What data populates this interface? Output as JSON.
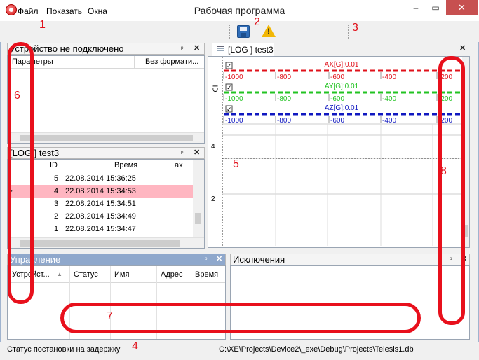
{
  "window": {
    "title": "Рабочая программа",
    "min": "–",
    "max": "▭",
    "close": "✕"
  },
  "menu": {
    "items": [
      "Файл",
      "Показать",
      "Окна"
    ]
  },
  "device_panel": {
    "title": "Устройство не подключено",
    "col_params": "Параметры",
    "col_format": "Без формати..."
  },
  "log_panel": {
    "title": "[LOG ] test3",
    "columns": [
      "ID",
      "Время",
      "ax"
    ],
    "rows": [
      {
        "id": "5",
        "time": "22.08.2014 15:36:25",
        "selected": false
      },
      {
        "id": "4",
        "time": "22.08.2014 15:34:53",
        "selected": true
      },
      {
        "id": "3",
        "time": "22.08.2014 15:34:51",
        "selected": false
      },
      {
        "id": "2",
        "time": "22.08.2014 15:34:49",
        "selected": false
      },
      {
        "id": "1",
        "time": "22.08.2014 15:34:47",
        "selected": false
      }
    ],
    "pointer": "▶"
  },
  "control_panel": {
    "title": "Управление",
    "columns": [
      "Устройст...",
      "Статус",
      "Имя",
      "Адрес",
      "Время"
    ]
  },
  "exceptions_panel": {
    "title": "Исключения"
  },
  "document_tab": {
    "label": "[LOG ] test3"
  },
  "chart_data": {
    "type": "line",
    "series": [
      {
        "name": "AX[G]:0.01",
        "color": "#e0101a",
        "checked": true,
        "ticks": [
          "-1000",
          "-800",
          "-600",
          "-400",
          "-200"
        ]
      },
      {
        "name": "AY[G]:0.01",
        "color": "#22c322",
        "checked": true,
        "ticks": [
          "-1000",
          "-800",
          "-600",
          "-400",
          "-200"
        ]
      },
      {
        "name": "AZ[G]:0.01",
        "color": "#1018c0",
        "checked": true,
        "ticks": [
          "-1000",
          "-800",
          "-600",
          "-400",
          "-200"
        ]
      }
    ],
    "y_tick_labels": [
      "4",
      "2"
    ],
    "side_label": "ID",
    "grid": true
  },
  "status": {
    "left": "Статус постановки на задержку",
    "right": "C:\\XE\\Projects\\Device2\\_exe\\Debug\\Projects\\Telesis1.db"
  },
  "annotations": [
    "1",
    "2",
    "3",
    "4",
    "5",
    "6",
    "7",
    "8"
  ],
  "pin_glyph": "ᵖ",
  "close_glyph": "✕",
  "check_glyph": "✓",
  "colors": {
    "annotation": "#e8101c",
    "selection": "#ffb6c1",
    "active_panel": "#8fa8cc"
  }
}
